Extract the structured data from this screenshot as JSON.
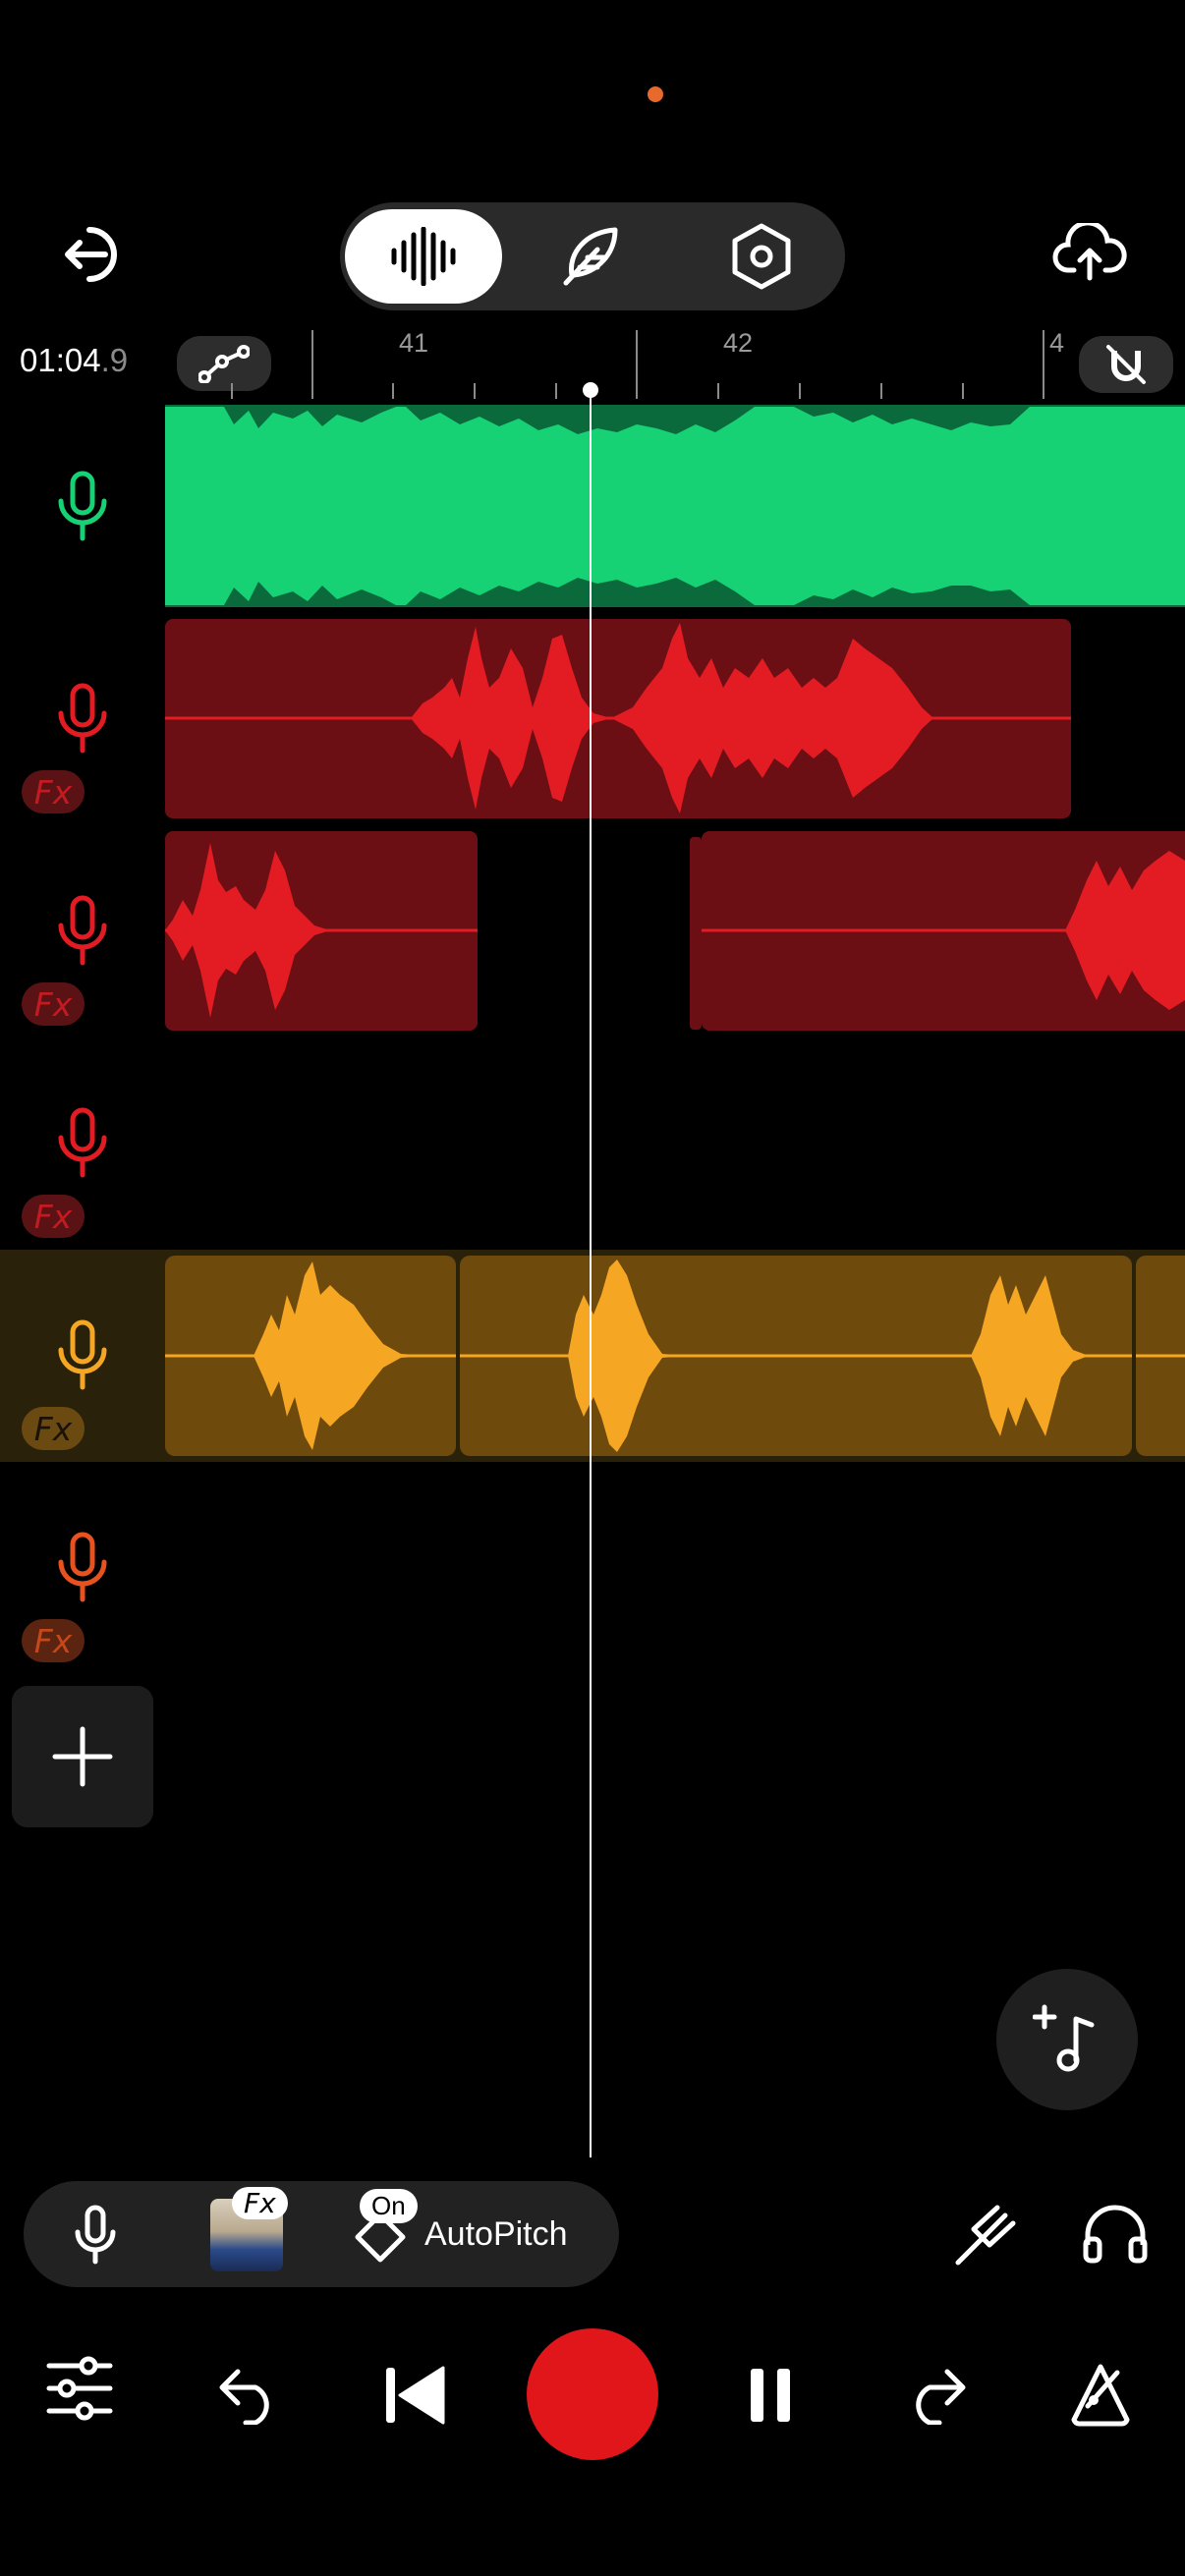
{
  "header": {
    "indicator_color": "#e8692c",
    "exit_icon": "exit-icon",
    "modes": [
      {
        "name": "waveform-mode",
        "icon": "waveform-icon",
        "active": true
      },
      {
        "name": "edit-mode",
        "icon": "feather-icon",
        "active": false
      },
      {
        "name": "settings-mode",
        "icon": "hex-settings-icon",
        "active": false
      }
    ],
    "cloud_icon": "cloud-upload-icon"
  },
  "timeline": {
    "time_main": "01:04",
    "time_frac": ".9",
    "markers": [
      "41",
      "42",
      "4"
    ],
    "automation_icon": "automation-icon",
    "snap_icon": "magnet-off-icon"
  },
  "tracks": [
    {
      "color": "#17d275",
      "dark": "#0a6a3c",
      "fx": false
    },
    {
      "color": "#e31b23",
      "dark": "#6b0f14",
      "fx": true,
      "fx_label": "Fx"
    },
    {
      "color": "#e31b23",
      "dark": "#6b0f14",
      "fx": true,
      "fx_label": "Fx"
    },
    {
      "color": "#e31b23",
      "dark": "#6b0f14",
      "fx": true,
      "fx_label": "Fx"
    },
    {
      "color": "#f5a623",
      "dark": "#6e4a0d",
      "fx": true,
      "fx_label": "Fx",
      "selected": true
    },
    {
      "color": "#e8521f",
      "dark": "#6b2a10",
      "fx": true,
      "fx_label": "Fx"
    }
  ],
  "controls": {
    "fx_label": "Fx",
    "on_label": "On",
    "autopitch_label": "AutoPitch"
  }
}
